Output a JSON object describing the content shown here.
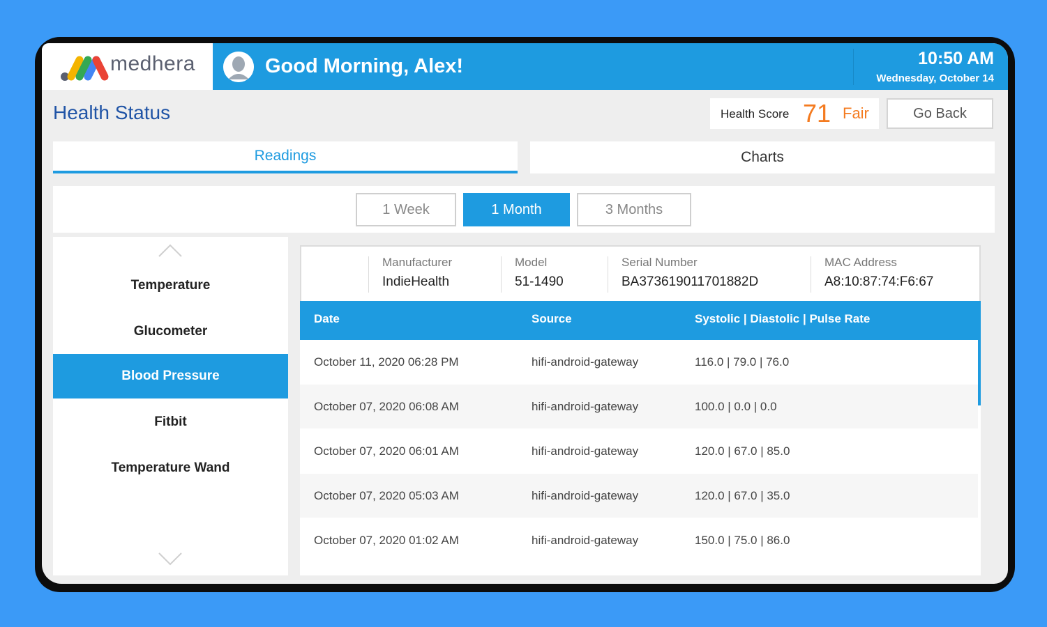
{
  "app": {
    "brand": "medhera",
    "greeting": "Good Morning, Alex!",
    "time": "10:50 AM",
    "date": "Wednesday, October 14"
  },
  "status": {
    "title": "Health Status",
    "score_label": "Health Score",
    "score_value": "71",
    "score_status": "Fair",
    "back_label": "Go Back"
  },
  "tabs": [
    {
      "label": "Readings",
      "active": true
    },
    {
      "label": "Charts",
      "active": false
    }
  ],
  "periods": [
    {
      "label": "1 Week",
      "active": false
    },
    {
      "label": "1 Month",
      "active": true
    },
    {
      "label": "3 Months",
      "active": false
    }
  ],
  "sidebar": {
    "items": [
      {
        "label": "Temperature"
      },
      {
        "label": "Glucometer"
      },
      {
        "label": "Blood Pressure",
        "active": true
      },
      {
        "label": "Fitbit"
      },
      {
        "label": "Temperature Wand"
      }
    ]
  },
  "device": {
    "manufacturer_label": "Manufacturer",
    "manufacturer": "IndieHealth",
    "model_label": "Model",
    "model": "51-1490",
    "serial_label": "Serial Number",
    "serial": "BA373619011701882D",
    "mac_label": "MAC Address",
    "mac": "A8:10:87:74:F6:67"
  },
  "table": {
    "columns": [
      "Date",
      "Source",
      "Systolic | Diastolic | Pulse Rate"
    ],
    "rows": [
      [
        "October 11, 2020 06:28 PM",
        "hifi-android-gateway",
        "116.0 | 79.0 | 76.0"
      ],
      [
        "October 07, 2020 06:08 AM",
        "hifi-android-gateway",
        "100.0 | 0.0 | 0.0"
      ],
      [
        "October 07, 2020 06:01 AM",
        "hifi-android-gateway",
        "120.0 | 67.0 | 85.0"
      ],
      [
        "October 07, 2020 05:03 AM",
        "hifi-android-gateway",
        "120.0 | 67.0 | 35.0"
      ],
      [
        "October 07, 2020 01:02 AM",
        "hifi-android-gateway",
        "150.0 | 75.0 | 86.0"
      ]
    ]
  },
  "colors": {
    "accent": "#1e9be0",
    "title": "#2054a6",
    "score": "#f47b20",
    "background": "#3b9af7"
  }
}
